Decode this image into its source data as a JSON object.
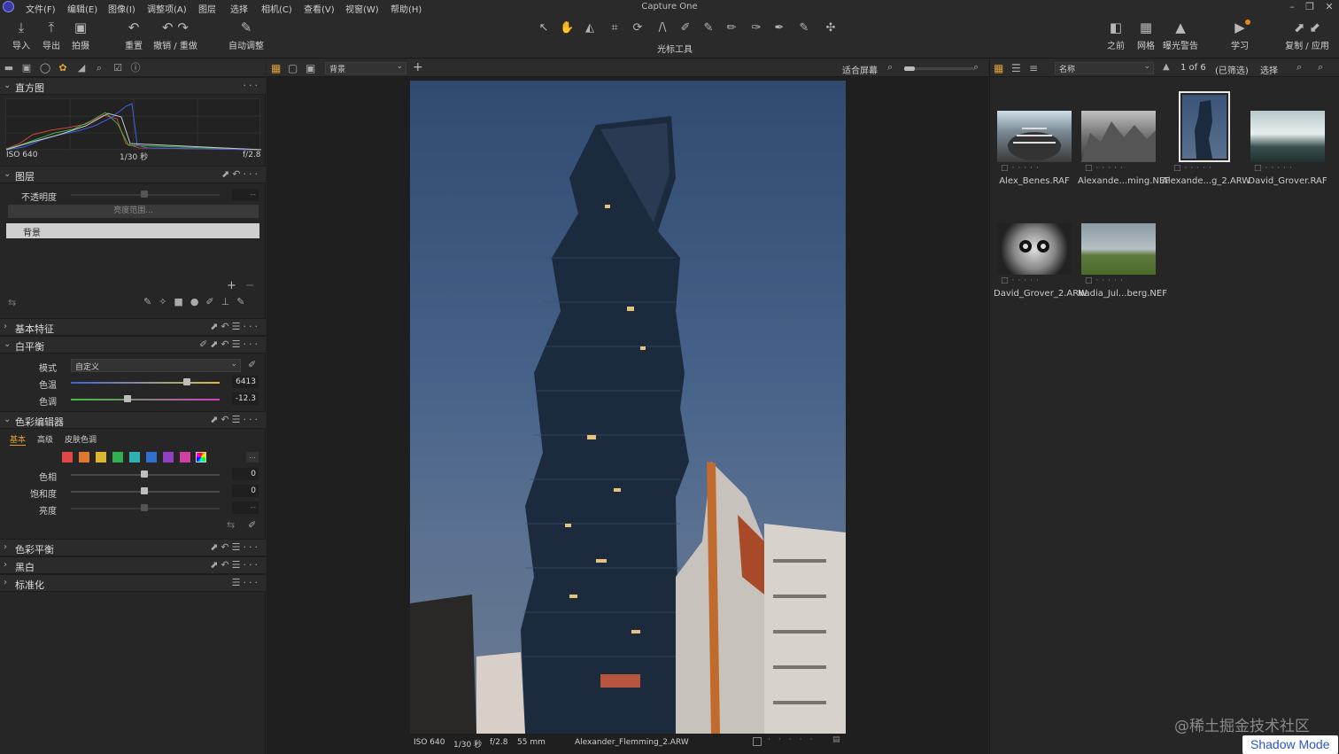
{
  "titlebar": {
    "app_title": "Capture One",
    "menus": [
      "文件(F)",
      "编辑(E)",
      "图像(I)",
      "调整项(A)",
      "图层",
      "选择",
      "相机(C)",
      "查看(V)",
      "视窗(W)",
      "帮助(H)"
    ]
  },
  "toolbar": {
    "left": [
      {
        "label": "导入",
        "icon": "import-icon"
      },
      {
        "label": "导出",
        "icon": "export-icon"
      },
      {
        "label": "拍摄",
        "icon": "camera-icon"
      },
      {
        "label": "重置",
        "icon": "reset-icon"
      },
      {
        "label": "撤销 / 重做",
        "icon": "undo-redo-icon"
      },
      {
        "label": "自动调整",
        "icon": "auto-adjust-icon"
      }
    ],
    "cursor_tools_label": "光标工具",
    "right": [
      {
        "label": "之前",
        "icon": "before-icon"
      },
      {
        "label": "网格",
        "icon": "grid-icon"
      },
      {
        "label": "曝光警告",
        "icon": "exposure-warning-icon"
      },
      {
        "label": "学习",
        "icon": "learn-icon"
      },
      {
        "label": "复制 / 应用",
        "icon": "copy-apply-icon"
      }
    ]
  },
  "left": {
    "histogram": {
      "title": "直方图",
      "iso": "ISO 640",
      "shutter": "1/30 秒",
      "aperture": "f/2.8"
    },
    "layers": {
      "title": "图层",
      "opacity_label": "不透明度",
      "opacity_value": "--",
      "range_button": "亮度范围...",
      "layer_name": "背景"
    },
    "basic": {
      "title": "基本特征"
    },
    "white_balance": {
      "title": "白平衡",
      "mode_label": "模式",
      "mode_value": "自定义",
      "kelvin_label": "色温",
      "kelvin_value": "6413",
      "tint_label": "色调",
      "tint_value": "-12.3",
      "kelvin_pos": 0.78,
      "tint_pos": 0.38
    },
    "color_editor": {
      "title": "色彩编辑器",
      "tabs": [
        "基本",
        "高级",
        "皮肤色调"
      ],
      "active_tab": "基本",
      "hue_label": "色相",
      "hue_value": "0",
      "sat_label": "饱和度",
      "sat_value": "0",
      "light_label": "亮度",
      "light_value": "--",
      "more": "...",
      "swatches": [
        "#e04848",
        "#e07830",
        "#d8b830",
        "#30b050",
        "#30b0b0",
        "#3070d0",
        "#9040c0",
        "#d040a0"
      ]
    },
    "color_balance": {
      "title": "色彩平衡"
    },
    "bw": {
      "title": "黑白"
    },
    "normalize": {
      "title": "标准化"
    }
  },
  "viewer": {
    "layer_select": "背景",
    "fit_label": "适合屏幕",
    "zoom_fraction": 0.15,
    "footer": {
      "iso": "ISO 640",
      "shutter": "1/30 秒",
      "aperture": "f/2.8",
      "focal": "55 mm",
      "filename": "Alexander_Flemming_2.ARW"
    }
  },
  "browser": {
    "sort_label": "名称",
    "count": "1 of 6",
    "filter": "(已筛选)",
    "select_label": "选择",
    "items": [
      {
        "name": "Alex_Benes.RAF",
        "selected": false
      },
      {
        "name": "Alexande...ming.NEF",
        "selected": false
      },
      {
        "name": "Alexande...g_2.ARW",
        "selected": true
      },
      {
        "name": "David_Grover.RAF",
        "selected": false
      },
      {
        "name": "David_Grover_2.ARW",
        "selected": false
      },
      {
        "name": "Nadia_Jul...berg.NEF",
        "selected": false
      }
    ]
  },
  "watermark": "@稀土掘金技术社区",
  "shadow_mode": "Shadow Mode"
}
